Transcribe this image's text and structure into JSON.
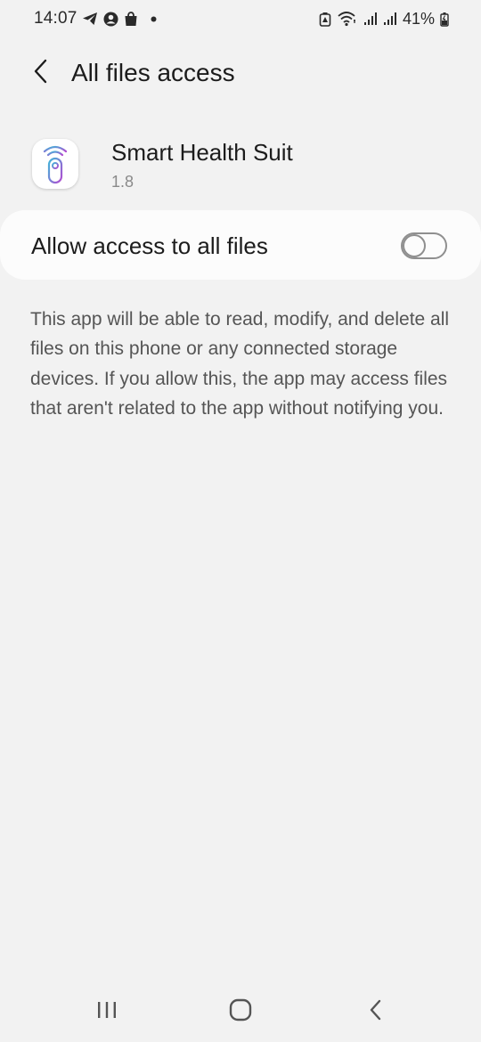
{
  "status_bar": {
    "time": "14:07",
    "battery_percent": "41%",
    "left_icons": [
      "telegram-icon",
      "account-icon",
      "shopping-bag-icon",
      "notification-dot-icon"
    ],
    "right_icons": [
      "battery-saver-icon",
      "wifi-icon",
      "signal-icon",
      "signal-icon",
      "battery-charging-icon"
    ]
  },
  "header": {
    "title": "All files access",
    "back_icon": "chevron-left-icon"
  },
  "app": {
    "name": "Smart Health Suit",
    "version": "1.8",
    "icon": "smart-health-app-icon"
  },
  "permission": {
    "label": "Allow access to all files",
    "enabled": false
  },
  "description": "This app will be able to read, modify, and delete all files on this phone or any connected storage devices. If you allow this, the app may access files that aren't related to the app without notifying you.",
  "nav_bar": {
    "icons": [
      "recent-apps-icon",
      "home-icon",
      "back-icon"
    ]
  },
  "colors": {
    "background": "#f2f2f2",
    "card": "#fcfcfc",
    "text_primary": "#1c1c1c",
    "text_secondary": "#555555",
    "text_muted": "#8a8a8a",
    "toggle_off": "#8f8f8f"
  }
}
